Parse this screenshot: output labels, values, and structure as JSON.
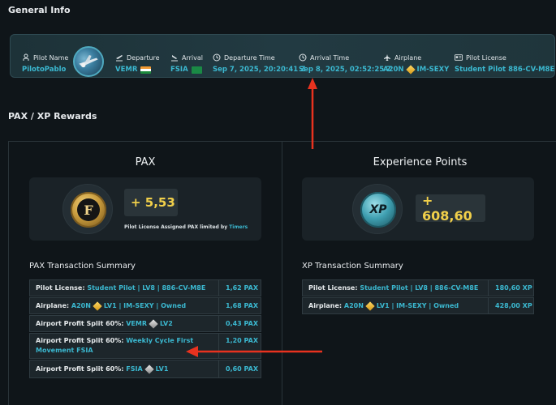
{
  "general_info": {
    "title": "General Info",
    "pilot_name": {
      "label": "Pilot Name",
      "value": "PilotoPablo",
      "icon": "pilot-icon"
    },
    "departure": {
      "label": "Departure",
      "value": "VEMR",
      "icon": "takeoff-icon",
      "flag": "india-flag"
    },
    "arrival": {
      "label": "Arrival",
      "value": "FSIA",
      "icon": "landing-icon",
      "flag": "seychelles-flag"
    },
    "departure_time": {
      "label": "Departure Time",
      "value": "Sep 7, 2025, 20:20:41 Z",
      "icon": "clock-icon"
    },
    "arrival_time": {
      "label": "Arrival Time",
      "value": "Sep 8, 2025, 02:52:25 Z",
      "icon": "clock-icon"
    },
    "airplane": {
      "label": "Airplane",
      "model": "A20N",
      "registration": "IM-SEXY",
      "icon": "airplane-icon"
    },
    "pilot_license": {
      "label": "Pilot License",
      "value": "Student Pilot  886-CV-M8E",
      "icon": "license-icon"
    }
  },
  "rewards": {
    "title": "PAX / XP Rewards",
    "pax": {
      "title": "PAX",
      "amount": "+ 5,53",
      "note_prefix": "Pilot License Assigned PAX limited by",
      "note_highlight": "Timers",
      "coin_letter": "F"
    },
    "xp": {
      "title": "Experience Points",
      "amount": "+ 608,60",
      "coin_letter": "XP"
    }
  },
  "pax_summary": {
    "title": "PAX Transaction Summary",
    "rows": [
      {
        "label": "Pilot License:",
        "parts": [
          "Student Pilot | LV8 | 886-CV-M8E"
        ],
        "value": "1,62 PAX"
      },
      {
        "label": "Airplane:",
        "parts": [
          "A20N",
          "LV1 | IM-SEXY | Owned"
        ],
        "value": "1,68 PAX"
      },
      {
        "label": "Airport Profit Split 60%:",
        "parts": [
          "VEMR",
          "LV2"
        ],
        "value": "0,43 PAX"
      },
      {
        "label": "Airport Profit Split 60%:",
        "parts": [
          "Weekly Cycle First Movement FSIA"
        ],
        "value": "1,20 PAX"
      },
      {
        "label": "Airport Profit Split 60%:",
        "parts": [
          "FSIA",
          "LV1"
        ],
        "value": "0,60 PAX"
      }
    ]
  },
  "xp_summary": {
    "title": "XP Transaction Summary",
    "rows": [
      {
        "label": "Pilot License:",
        "parts": [
          "Student Pilot | LV8 | 886-CV-M8E"
        ],
        "value": "180,60 XP"
      },
      {
        "label": "Airplane:",
        "parts": [
          "A20N",
          "LV1 | IM-SEXY | Owned"
        ],
        "value": "428,00 XP"
      }
    ]
  },
  "colors": {
    "accent": "#3bb8d0",
    "gold": "#f1d04a",
    "annotation": "#e8321f",
    "background": "#0f1519"
  }
}
